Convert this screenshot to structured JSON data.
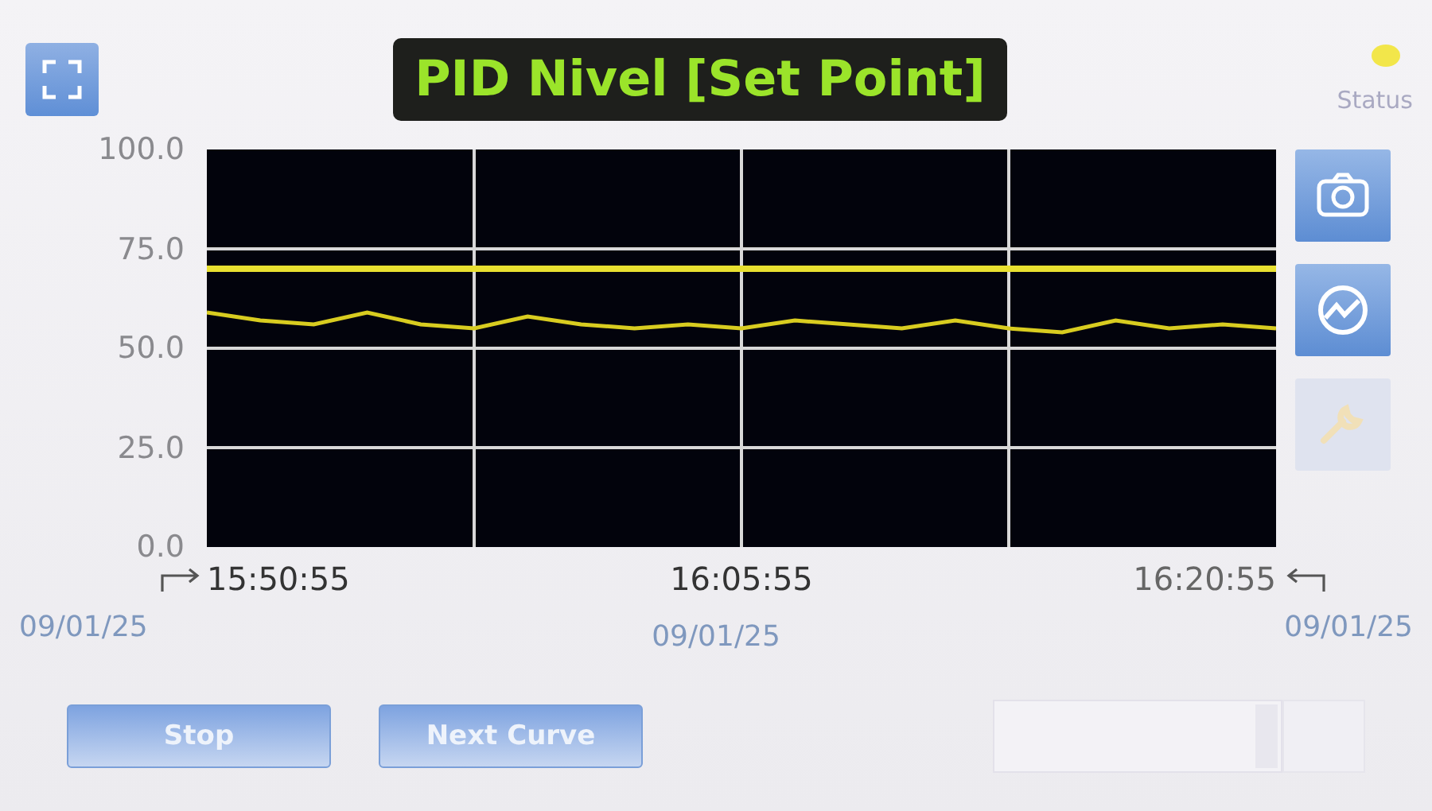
{
  "title": "PID Nivel [Set Point]",
  "status": {
    "label": "Status",
    "color": "#f2e64a"
  },
  "chart": {
    "chart_data": {
      "type": "line",
      "grid": true,
      "ylim": [
        0,
        100
      ],
      "yticks": [
        {
          "value": 0,
          "label": "0.0"
        },
        {
          "value": 25,
          "label": "25.0"
        },
        {
          "value": 50,
          "label": "50.0"
        },
        {
          "value": 75,
          "label": "75.0"
        },
        {
          "value": 100,
          "label": "100.0"
        }
      ],
      "series": [
        {
          "color": "#e8e030",
          "values": [
            70,
            70,
            70,
            70,
            70,
            70,
            70,
            70,
            70,
            70,
            70,
            70,
            70,
            70,
            70,
            70,
            70,
            70,
            70,
            70,
            70
          ]
        },
        {
          "color": "#d8cc20",
          "values": [
            59,
            57,
            56,
            59,
            56,
            55,
            58,
            56,
            55,
            56,
            55,
            57,
            56,
            55,
            57,
            55,
            54,
            57,
            55,
            56,
            55
          ]
        }
      ]
    },
    "time_labels": [
      "15:50:55",
      "16:05:55",
      "16:20:55"
    ],
    "dates": [
      "09/01/25",
      "09/01/25",
      "09/01/25"
    ]
  },
  "tools": [
    {
      "kind": "camera",
      "disabled": false
    },
    {
      "kind": "trend",
      "disabled": false
    },
    {
      "kind": "tool",
      "disabled": true
    }
  ],
  "buttons": [
    "Stop",
    "Next Curve"
  ]
}
